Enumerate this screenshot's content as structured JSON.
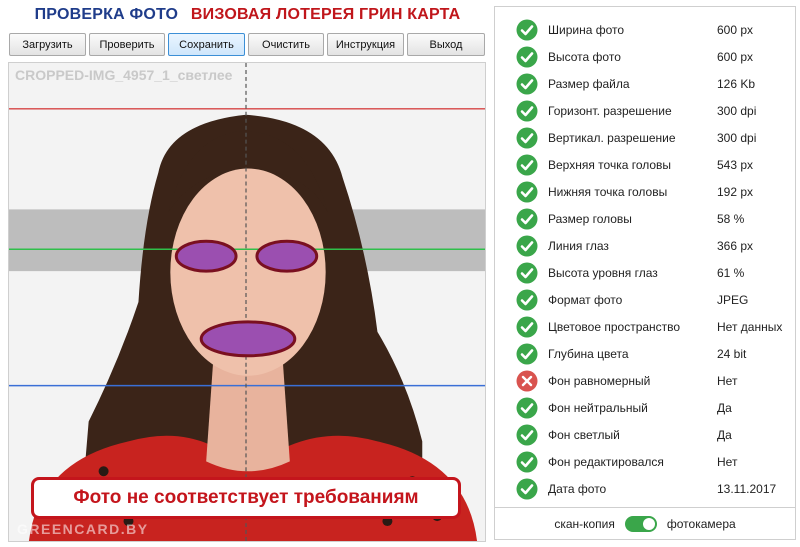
{
  "header": {
    "title_left": "ПРОВЕРКА ФОТО",
    "title_right": "ВИЗОВАЯ ЛОТЕРЕЯ ГРИН КАРТА"
  },
  "toolbar": {
    "load": "Загрузить",
    "check": "Проверить",
    "save": "Сохранить",
    "clear": "Очистить",
    "instructions": "Инструкция",
    "exit": "Выход"
  },
  "photo": {
    "filename": "CROPPED-IMG_4957_1_светлее",
    "verdict": "Фото не соответствует требованиям",
    "watermark": "GREENCARD.BY"
  },
  "checks": [
    {
      "label": "Ширина фото",
      "value": "600 px",
      "status": "ok"
    },
    {
      "label": "Высота фото",
      "value": "600 px",
      "status": "ok"
    },
    {
      "label": "Размер файла",
      "value": "126 Kb",
      "status": "ok"
    },
    {
      "label": "Горизонт. разрешение",
      "value": "300 dpi",
      "status": "ok"
    },
    {
      "label": "Вертикал. разрешение",
      "value": "300 dpi",
      "status": "ok"
    },
    {
      "label": "Верхняя точка головы",
      "value": "543 px",
      "status": "ok"
    },
    {
      "label": "Нижняя точка головы",
      "value": "192 px",
      "status": "ok"
    },
    {
      "label": "Размер головы",
      "value": "58 %",
      "status": "ok"
    },
    {
      "label": "Линия глаз",
      "value": "366 px",
      "status": "ok"
    },
    {
      "label": "Высота уровня глаз",
      "value": "61 %",
      "status": "ok"
    },
    {
      "label": "Формат фото",
      "value": "JPEG",
      "status": "ok"
    },
    {
      "label": "Цветовое пространство",
      "value": "Нет данных",
      "status": "ok"
    },
    {
      "label": "Глубина цвета",
      "value": "24 bit",
      "status": "ok"
    },
    {
      "label": "Фон равномерный",
      "value": "Нет",
      "status": "fail"
    },
    {
      "label": "Фон нейтральный",
      "value": "Да",
      "status": "ok"
    },
    {
      "label": "Фон светлый",
      "value": "Да",
      "status": "ok"
    },
    {
      "label": "Фон редактировался",
      "value": "Нет",
      "status": "ok"
    },
    {
      "label": "Дата фото",
      "value": "13.11.2017",
      "status": "ok"
    }
  ],
  "source_toggle": {
    "left_label": "скан-копия",
    "right_label": "фотокамера",
    "state": "фотокамера"
  },
  "colors": {
    "ok": "#3aa64a",
    "fail": "#d9534f",
    "title_blue": "#1f3c8a",
    "title_red": "#c0161b"
  }
}
